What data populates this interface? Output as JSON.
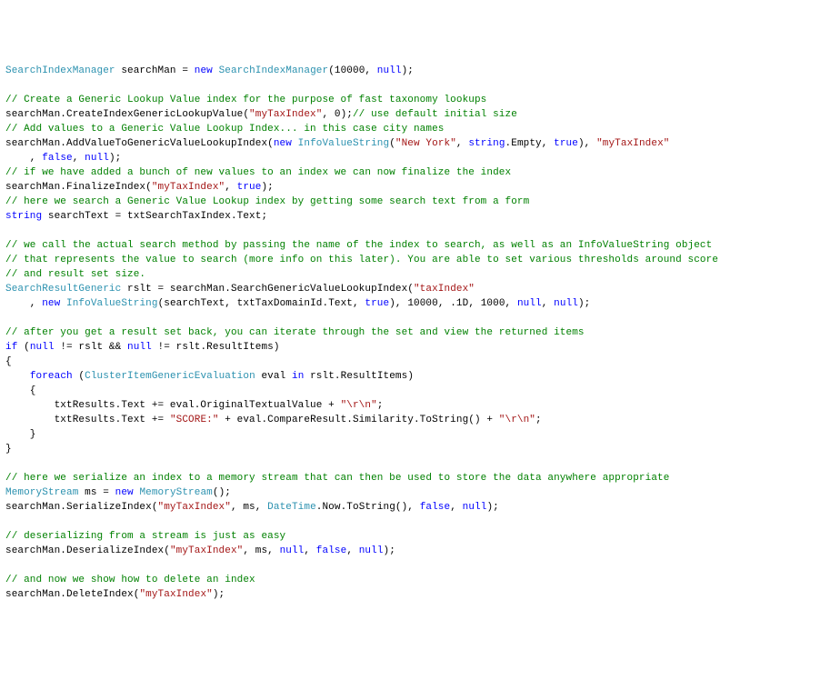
{
  "lines": [
    [
      {
        "c": "tk-type",
        "t": "SearchIndexManager"
      },
      {
        "c": "tk-text",
        "t": " searchMan = "
      },
      {
        "c": "tk-keyword",
        "t": "new"
      },
      {
        "c": "tk-text",
        "t": " "
      },
      {
        "c": "tk-type",
        "t": "SearchIndexManager"
      },
      {
        "c": "tk-text",
        "t": "(10000, "
      },
      {
        "c": "tk-keyword",
        "t": "null"
      },
      {
        "c": "tk-text",
        "t": ");"
      }
    ],
    [],
    [
      {
        "c": "tk-comment",
        "t": "// Create a Generic Lookup Value index for the purpose of fast taxonomy lookups"
      }
    ],
    [
      {
        "c": "tk-text",
        "t": "searchMan.CreateIndexGenericLookupValue("
      },
      {
        "c": "tk-string",
        "t": "\"myTaxIndex\""
      },
      {
        "c": "tk-text",
        "t": ", 0);"
      },
      {
        "c": "tk-comment",
        "t": "// use default initial size"
      }
    ],
    [
      {
        "c": "tk-comment",
        "t": "// Add values to a Generic Value Lookup Index... in this case city names"
      }
    ],
    [
      {
        "c": "tk-text",
        "t": "searchMan.AddValueToGenericValueLookupIndex("
      },
      {
        "c": "tk-keyword",
        "t": "new"
      },
      {
        "c": "tk-text",
        "t": " "
      },
      {
        "c": "tk-type",
        "t": "InfoValueString"
      },
      {
        "c": "tk-text",
        "t": "("
      },
      {
        "c": "tk-string",
        "t": "\"New York\""
      },
      {
        "c": "tk-text",
        "t": ", "
      },
      {
        "c": "tk-keyword",
        "t": "string"
      },
      {
        "c": "tk-text",
        "t": ".Empty, "
      },
      {
        "c": "tk-keyword",
        "t": "true"
      },
      {
        "c": "tk-text",
        "t": "), "
      },
      {
        "c": "tk-string",
        "t": "\"myTaxIndex\""
      }
    ],
    [
      {
        "c": "tk-text",
        "t": "    , "
      },
      {
        "c": "tk-keyword",
        "t": "false"
      },
      {
        "c": "tk-text",
        "t": ", "
      },
      {
        "c": "tk-keyword",
        "t": "null"
      },
      {
        "c": "tk-text",
        "t": ");"
      }
    ],
    [
      {
        "c": "tk-comment",
        "t": "// if we have added a bunch of new values to an index we can now finalize the index"
      }
    ],
    [
      {
        "c": "tk-text",
        "t": "searchMan.FinalizeIndex("
      },
      {
        "c": "tk-string",
        "t": "\"myTaxIndex\""
      },
      {
        "c": "tk-text",
        "t": ", "
      },
      {
        "c": "tk-keyword",
        "t": "true"
      },
      {
        "c": "tk-text",
        "t": ");"
      }
    ],
    [
      {
        "c": "tk-comment",
        "t": "// here we search a Generic Value Lookup index by getting some search text from a form"
      }
    ],
    [
      {
        "c": "tk-keyword",
        "t": "string"
      },
      {
        "c": "tk-text",
        "t": " searchText = txtSearchTaxIndex.Text;"
      }
    ],
    [],
    [
      {
        "c": "tk-comment",
        "t": "// we call the actual search method by passing the name of the index to search, as well as an InfoValueString object"
      }
    ],
    [
      {
        "c": "tk-comment",
        "t": "// that represents the value to search (more info on this later). You are able to set various thresholds around score"
      }
    ],
    [
      {
        "c": "tk-comment",
        "t": "// and result set size."
      }
    ],
    [
      {
        "c": "tk-type",
        "t": "SearchResultGeneric"
      },
      {
        "c": "tk-text",
        "t": " rslt = searchMan.SearchGenericValueLookupIndex("
      },
      {
        "c": "tk-string",
        "t": "\"taxIndex\""
      }
    ],
    [
      {
        "c": "tk-text",
        "t": "    , "
      },
      {
        "c": "tk-keyword",
        "t": "new"
      },
      {
        "c": "tk-text",
        "t": " "
      },
      {
        "c": "tk-type",
        "t": "InfoValueString"
      },
      {
        "c": "tk-text",
        "t": "(searchText, txtTaxDomainId.Text, "
      },
      {
        "c": "tk-keyword",
        "t": "true"
      },
      {
        "c": "tk-text",
        "t": "), 10000, .1D, 1000, "
      },
      {
        "c": "tk-keyword",
        "t": "null"
      },
      {
        "c": "tk-text",
        "t": ", "
      },
      {
        "c": "tk-keyword",
        "t": "null"
      },
      {
        "c": "tk-text",
        "t": ");"
      }
    ],
    [],
    [
      {
        "c": "tk-comment",
        "t": "// after you get a result set back, you can iterate through the set and view the returned items"
      }
    ],
    [
      {
        "c": "tk-keyword",
        "t": "if"
      },
      {
        "c": "tk-text",
        "t": " ("
      },
      {
        "c": "tk-keyword",
        "t": "null"
      },
      {
        "c": "tk-text",
        "t": " != rslt && "
      },
      {
        "c": "tk-keyword",
        "t": "null"
      },
      {
        "c": "tk-text",
        "t": " != rslt.ResultItems)"
      }
    ],
    [
      {
        "c": "tk-text",
        "t": "{"
      }
    ],
    [
      {
        "c": "tk-text",
        "t": "    "
      },
      {
        "c": "tk-keyword",
        "t": "foreach"
      },
      {
        "c": "tk-text",
        "t": " ("
      },
      {
        "c": "tk-type",
        "t": "ClusterItemGenericEvaluation"
      },
      {
        "c": "tk-text",
        "t": " eval "
      },
      {
        "c": "tk-keyword",
        "t": "in"
      },
      {
        "c": "tk-text",
        "t": " rslt.ResultItems)"
      }
    ],
    [
      {
        "c": "tk-text",
        "t": "    {"
      }
    ],
    [
      {
        "c": "tk-text",
        "t": "        txtResults.Text += eval.OriginalTextualValue + "
      },
      {
        "c": "tk-string",
        "t": "\"\\r\\n\""
      },
      {
        "c": "tk-text",
        "t": ";"
      }
    ],
    [
      {
        "c": "tk-text",
        "t": "        txtResults.Text += "
      },
      {
        "c": "tk-string",
        "t": "\"SCORE:\""
      },
      {
        "c": "tk-text",
        "t": " + eval.CompareResult.Similarity.ToString() + "
      },
      {
        "c": "tk-string",
        "t": "\"\\r\\n\""
      },
      {
        "c": "tk-text",
        "t": ";"
      }
    ],
    [
      {
        "c": "tk-text",
        "t": "    }"
      }
    ],
    [
      {
        "c": "tk-text",
        "t": "}"
      }
    ],
    [],
    [
      {
        "c": "tk-comment",
        "t": "// here we serialize an index to a memory stream that can then be used to store the data anywhere appropriate"
      }
    ],
    [
      {
        "c": "tk-type",
        "t": "MemoryStream"
      },
      {
        "c": "tk-text",
        "t": " ms = "
      },
      {
        "c": "tk-keyword",
        "t": "new"
      },
      {
        "c": "tk-text",
        "t": " "
      },
      {
        "c": "tk-type",
        "t": "MemoryStream"
      },
      {
        "c": "tk-text",
        "t": "();"
      }
    ],
    [
      {
        "c": "tk-text",
        "t": "searchMan.SerializeIndex("
      },
      {
        "c": "tk-string",
        "t": "\"myTaxIndex\""
      },
      {
        "c": "tk-text",
        "t": ", ms, "
      },
      {
        "c": "tk-type",
        "t": "DateTime"
      },
      {
        "c": "tk-text",
        "t": ".Now.ToString(), "
      },
      {
        "c": "tk-keyword",
        "t": "false"
      },
      {
        "c": "tk-text",
        "t": ", "
      },
      {
        "c": "tk-keyword",
        "t": "null"
      },
      {
        "c": "tk-text",
        "t": ");"
      }
    ],
    [],
    [
      {
        "c": "tk-comment",
        "t": "// deserializing from a stream is just as easy"
      }
    ],
    [
      {
        "c": "tk-text",
        "t": "searchMan.DeserializeIndex("
      },
      {
        "c": "tk-string",
        "t": "\"myTaxIndex\""
      },
      {
        "c": "tk-text",
        "t": ", ms, "
      },
      {
        "c": "tk-keyword",
        "t": "null"
      },
      {
        "c": "tk-text",
        "t": ", "
      },
      {
        "c": "tk-keyword",
        "t": "false"
      },
      {
        "c": "tk-text",
        "t": ", "
      },
      {
        "c": "tk-keyword",
        "t": "null"
      },
      {
        "c": "tk-text",
        "t": ");"
      }
    ],
    [],
    [
      {
        "c": "tk-comment",
        "t": "// and now we show how to delete an index"
      }
    ],
    [
      {
        "c": "tk-text",
        "t": "searchMan.DeleteIndex("
      },
      {
        "c": "tk-string",
        "t": "\"myTaxIndex\""
      },
      {
        "c": "tk-text",
        "t": ");"
      }
    ]
  ]
}
